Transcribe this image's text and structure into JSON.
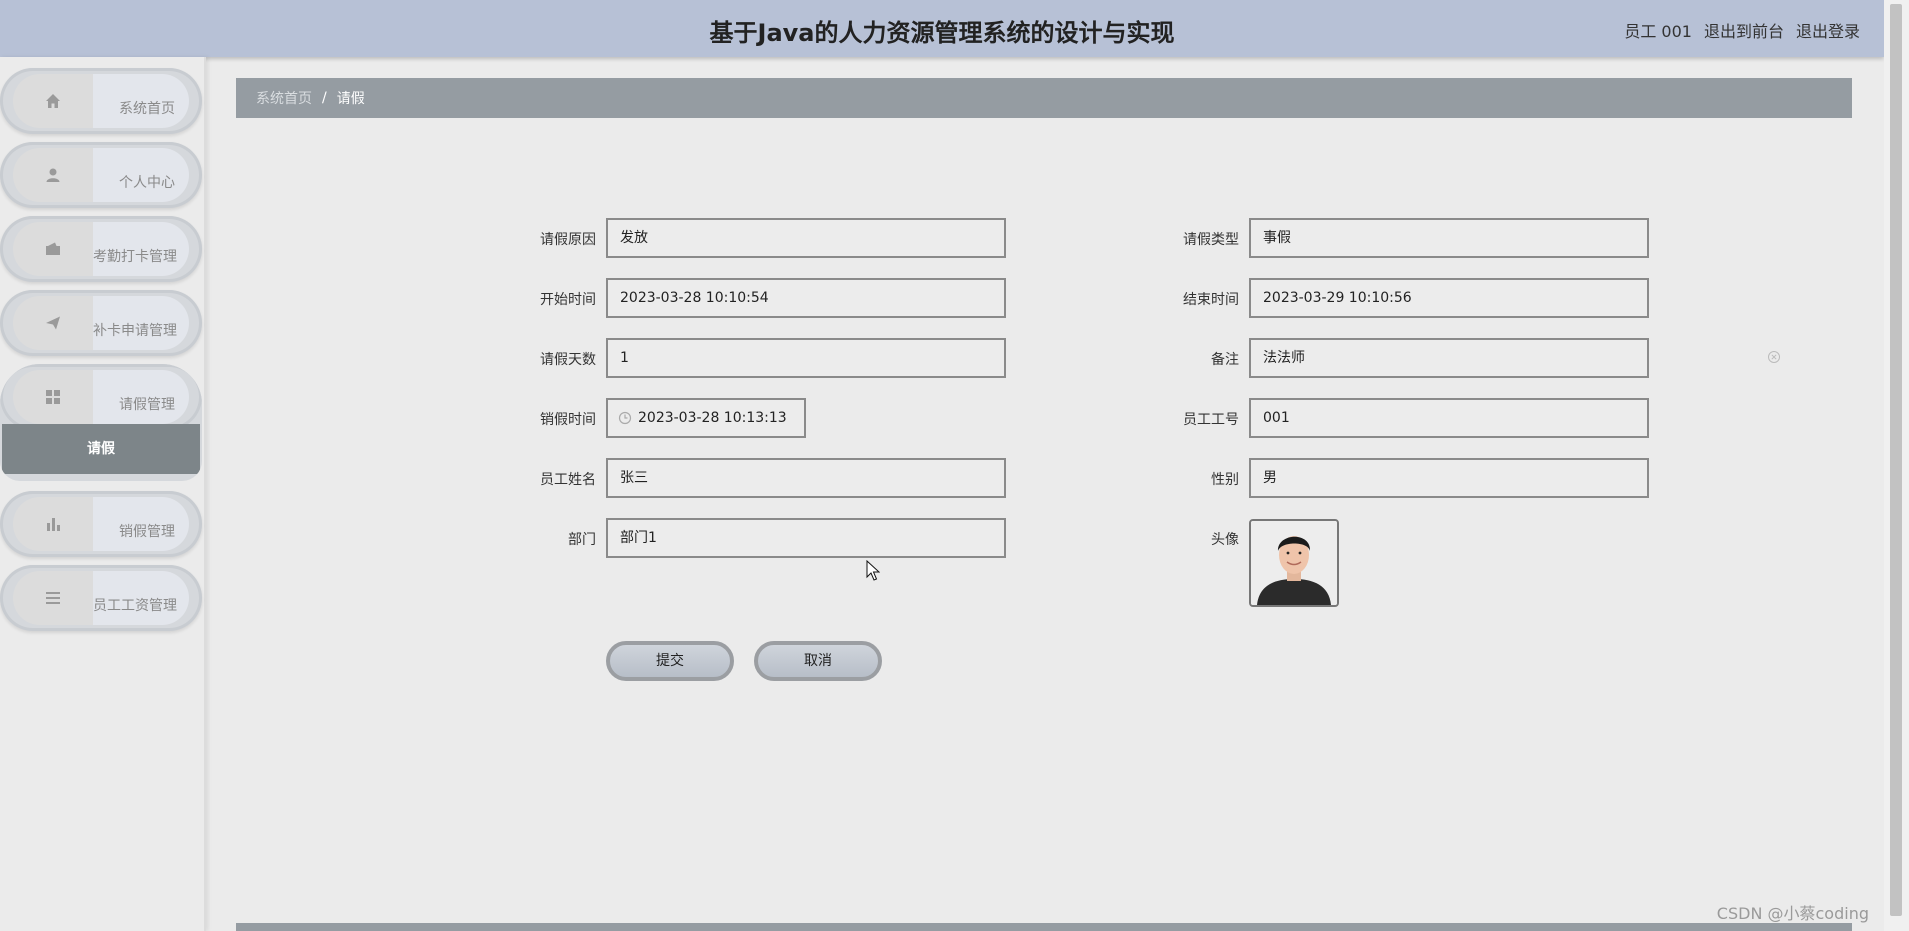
{
  "header": {
    "title": "基于Java的人力资源管理系统的设计与实现",
    "user": "员工 001",
    "back_to_front": "退出到前台",
    "logout": "退出登录"
  },
  "sidebar": {
    "items": [
      {
        "label": "系统首页",
        "icon": "home-icon"
      },
      {
        "label": "个人中心",
        "icon": "user-icon"
      },
      {
        "label": "考勤打卡管理",
        "icon": "wallet-icon"
      },
      {
        "label": "补卡申请管理",
        "icon": "send-icon"
      },
      {
        "label": "请假管理",
        "icon": "grid-icon"
      },
      {
        "label": "销假管理",
        "icon": "bar-chart-icon"
      },
      {
        "label": "员工工资管理",
        "icon": "menu-icon"
      }
    ],
    "active_sub": "请假"
  },
  "breadcrumb": {
    "home": "系统首页",
    "separator": "/",
    "current": "请假"
  },
  "form": {
    "leave_reason": {
      "label": "请假原因",
      "value": "发放"
    },
    "leave_type": {
      "label": "请假类型",
      "value": "事假"
    },
    "start_time": {
      "label": "开始时间",
      "value": "2023-03-28 10:10:54"
    },
    "end_time": {
      "label": "结束时间",
      "value": "2023-03-29 10:10:56"
    },
    "leave_days": {
      "label": "请假天数",
      "value": "1"
    },
    "remark": {
      "label": "备注",
      "value": "法法师"
    },
    "cancel_time": {
      "label": "销假时间",
      "value": "2023-03-28 10:13:13"
    },
    "employee_id": {
      "label": "员工工号",
      "value": "001"
    },
    "employee_name": {
      "label": "员工姓名",
      "value": "张三"
    },
    "gender": {
      "label": "性别",
      "value": "男"
    },
    "department": {
      "label": "部门",
      "value": "部门1"
    },
    "avatar": {
      "label": "头像"
    }
  },
  "buttons": {
    "submit": "提交",
    "cancel": "取消"
  },
  "watermark": "CSDN @小蔡coding"
}
